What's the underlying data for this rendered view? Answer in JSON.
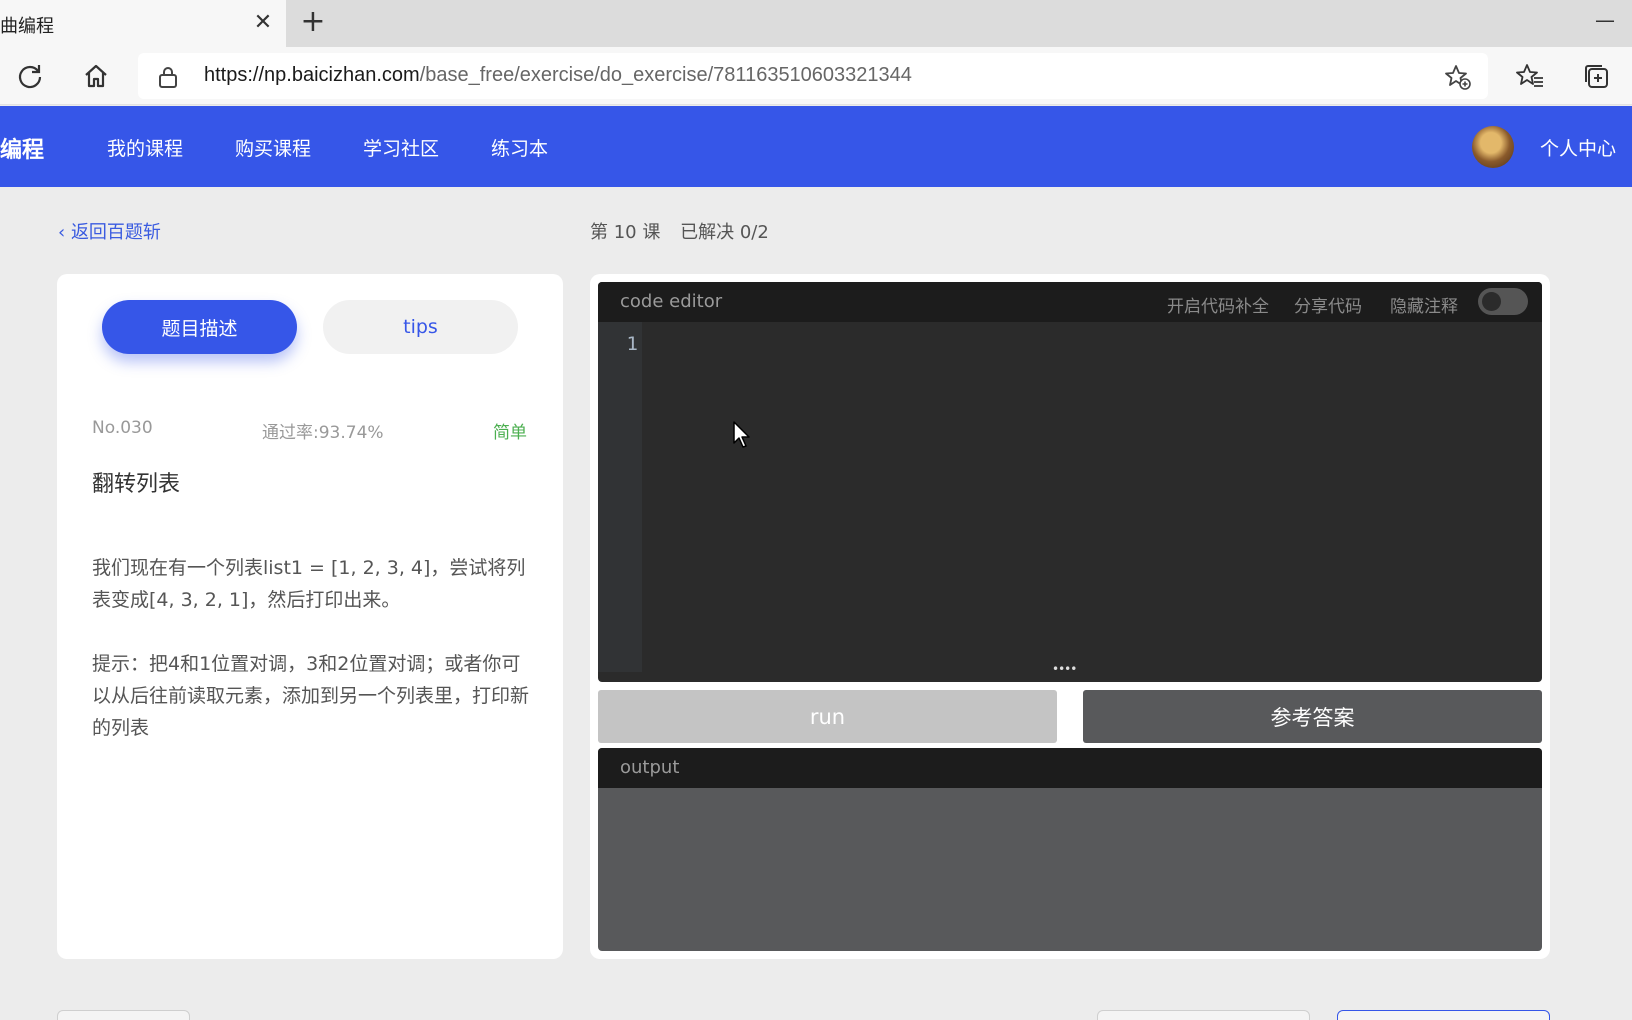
{
  "browser": {
    "tab_title": "曲编程",
    "url_host": "https://np.baicizhan.com",
    "url_path": "/base_free/exercise/do_exercise/781163510603321344"
  },
  "nav": {
    "brand": "编程",
    "items": [
      "我的课程",
      "购买课程",
      "学习社区",
      "练习本"
    ],
    "profile": "个人中心"
  },
  "subheader": {
    "back_label": "返回百题斩",
    "lesson": "第 10 课",
    "solved": "已解决 0/2"
  },
  "problem": {
    "tabs": [
      "题目描述",
      "tips"
    ],
    "number": "No.030",
    "pass_rate": "通过率:93.74%",
    "difficulty": "简单",
    "title": "翻转列表",
    "description": "我们现在有一个列表list1 = [1, 2, 3, 4]，尝试将列表变成[4, 3, 2, 1]，然后打印出来。",
    "hint": "提示：把4和1位置对调，3和2位置对调；或者你可以从后往前读取元素，添加到另一个列表里，打印新的列表"
  },
  "editor": {
    "title": "code editor",
    "autocomplete_label": "开启代码补全",
    "share_label": "分享代码",
    "hide_comments_label": "隐藏注释",
    "hide_comments_on": false,
    "line_number": "1"
  },
  "actions": {
    "run_label": "run",
    "answer_label": "参考答案"
  },
  "output": {
    "title": "output"
  },
  "colors": {
    "brand_blue": "#3656e8",
    "difficulty_green": "#4caf50"
  }
}
